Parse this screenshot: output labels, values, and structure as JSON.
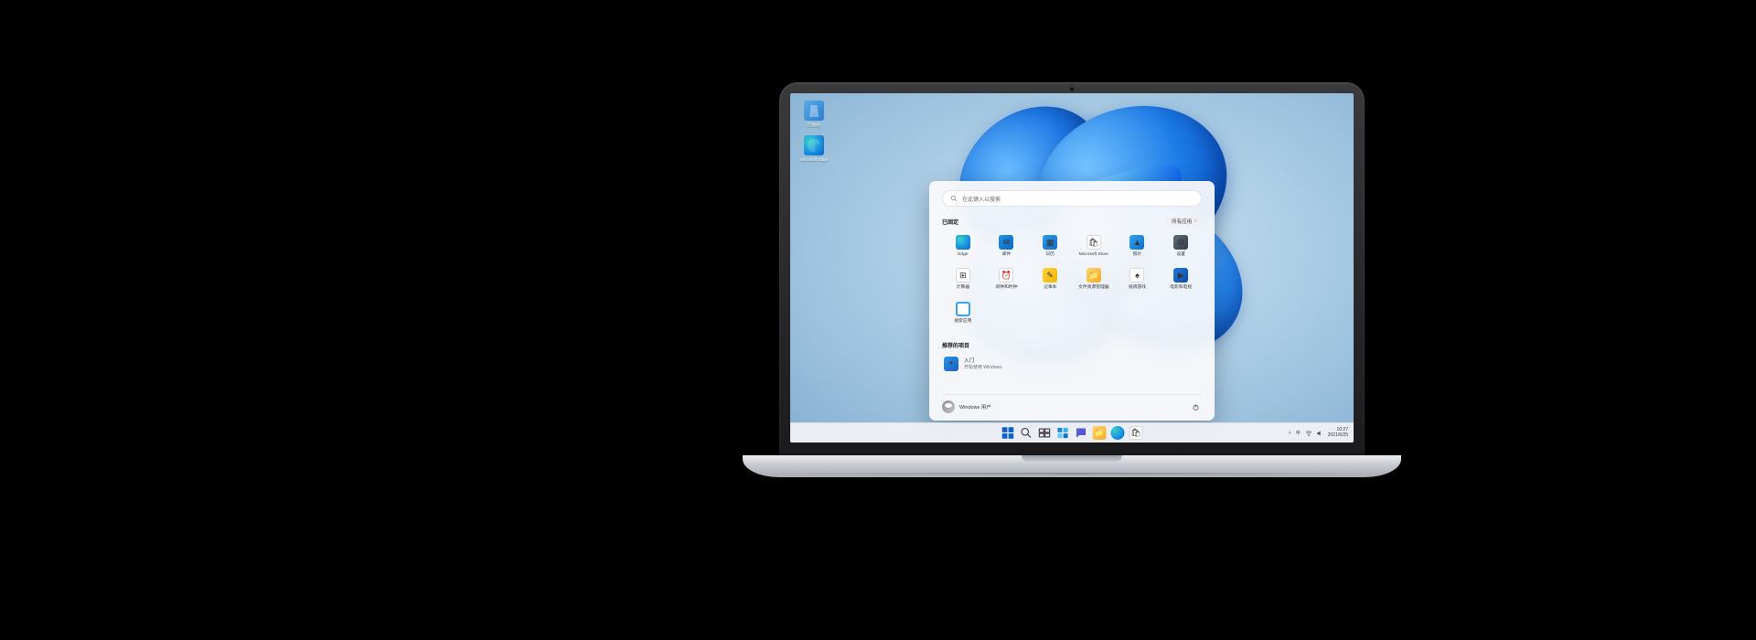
{
  "desktop": {
    "icons": [
      {
        "name": "recycle-bin",
        "label": "回收站"
      },
      {
        "name": "edge",
        "label": "Microsoft Edge"
      }
    ]
  },
  "start_menu": {
    "search_placeholder": "在此键入以搜索",
    "pinned_header": "已固定",
    "all_apps_label": "所有应用",
    "recommended_header": "推荐的项目",
    "pinned": [
      {
        "name": "edge",
        "label": "Edge"
      },
      {
        "name": "mail",
        "label": "邮件"
      },
      {
        "name": "calendar",
        "label": "日历"
      },
      {
        "name": "store",
        "label": "Microsoft Store"
      },
      {
        "name": "photos",
        "label": "照片"
      },
      {
        "name": "settings",
        "label": "设置"
      },
      {
        "name": "calculator",
        "label": "计算器"
      },
      {
        "name": "alarms",
        "label": "闹钟和时钟"
      },
      {
        "name": "notepad",
        "label": "记事本"
      },
      {
        "name": "explorer",
        "label": "文件资源管理器"
      },
      {
        "name": "solitaire",
        "label": "纸牌游戏"
      },
      {
        "name": "movies",
        "label": "电影和电视"
      },
      {
        "name": "cortana",
        "label": "搜索应用"
      }
    ],
    "recommended": [
      {
        "name": "tips",
        "title": "入门",
        "subtitle": "开始使用 Windows"
      }
    ],
    "user": "Windows 用户"
  },
  "taskbar": {
    "items": [
      {
        "name": "start",
        "hint": "开始"
      },
      {
        "name": "search",
        "hint": "搜索"
      },
      {
        "name": "taskview",
        "hint": "任务视图"
      },
      {
        "name": "widgets",
        "hint": "小组件"
      },
      {
        "name": "chat",
        "hint": "聊天"
      },
      {
        "name": "explorer",
        "hint": "文件资源管理器"
      },
      {
        "name": "edge",
        "hint": "Microsoft Edge"
      },
      {
        "name": "store",
        "hint": "Microsoft Store"
      }
    ],
    "systray": {
      "chevron": "˄",
      "ime": "中",
      "time": "10:27",
      "date": "2021/6/25"
    }
  }
}
